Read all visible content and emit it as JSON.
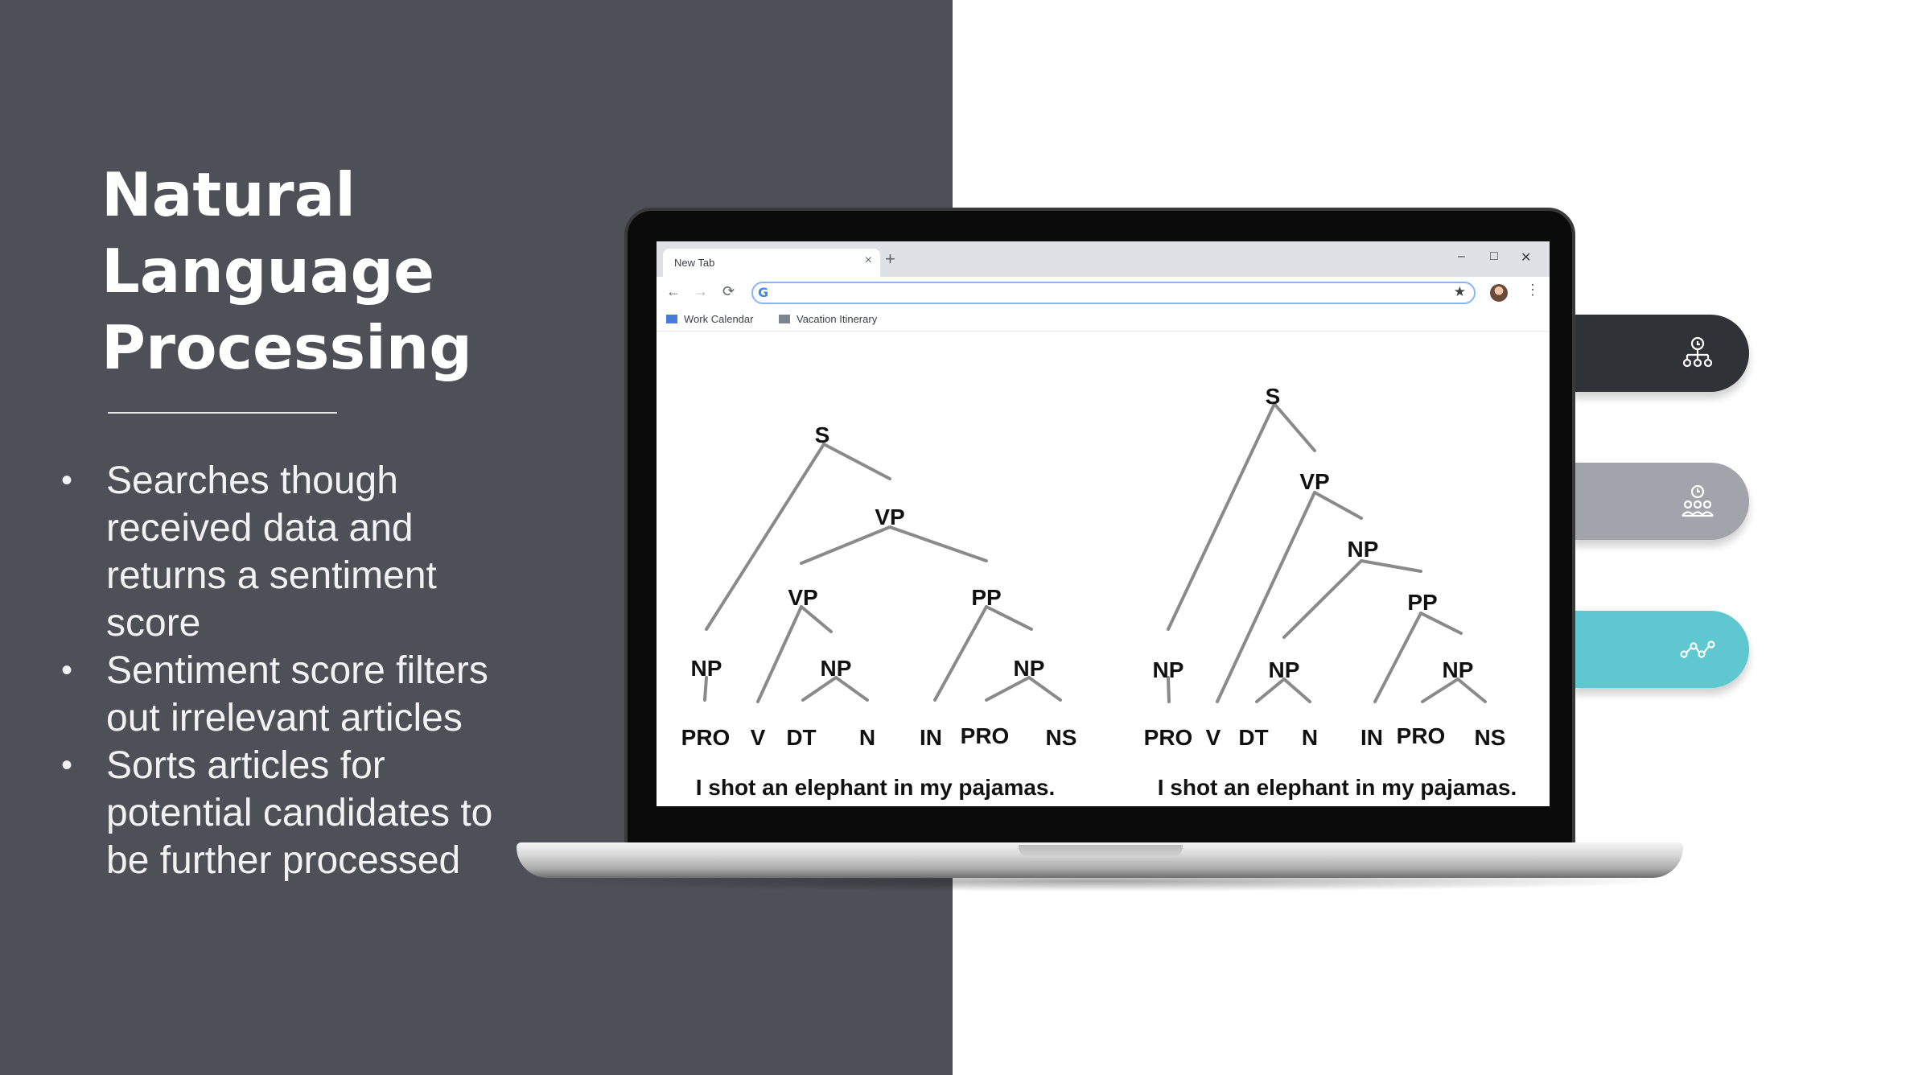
{
  "slide": {
    "title_lines": [
      "Natural",
      "Language",
      "Processing"
    ],
    "bullets": [
      "Searches though received data and returns a sentiment score",
      "Sentiment score filters out irrelevant articles",
      "Sorts articles for potential candidates to be further processed"
    ]
  },
  "browser": {
    "tab_title": "New Tab",
    "tab_close": "×",
    "new_tab": "+",
    "minimize": "–",
    "maximize": "□",
    "close": "✕",
    "back": "←",
    "forward": "→",
    "reload": "⟳",
    "search_logo": "G",
    "bookmark_star": "★",
    "menu": "⋮",
    "bookmarks": [
      "Work Calendar",
      "Vacation Itinerary"
    ]
  },
  "trees": {
    "left": {
      "sentence": "I shot an elephant in my pajamas.",
      "labels": [
        "S",
        "VP",
        "VP",
        "PP",
        "NP",
        "NP",
        "NP",
        "PRO",
        "V",
        "DT",
        "N",
        "IN",
        "PRO",
        "NS"
      ]
    },
    "right": {
      "sentence": "I shot an elephant in my pajamas.",
      "labels": [
        "S",
        "VP",
        "NP",
        "PP",
        "NP",
        "NP",
        "NP",
        "PRO",
        "V",
        "DT",
        "N",
        "IN",
        "PRO",
        "NS"
      ]
    }
  },
  "side_tabs": [
    {
      "icon": "hierarchy-icon",
      "color": "#2f3236"
    },
    {
      "icon": "team-icon",
      "color": "#a1a5ab"
    },
    {
      "icon": "line-graph-icon",
      "color": "#5fc7cf"
    }
  ],
  "colors": {
    "left_panel": "#4d5057",
    "tree_lines": "#8a8a8a"
  }
}
